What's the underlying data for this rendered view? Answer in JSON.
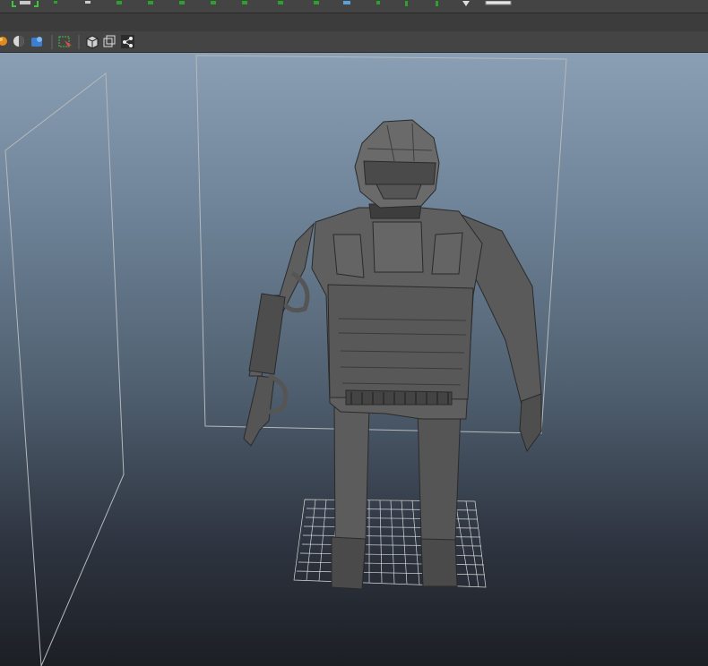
{
  "app": {
    "name": "3D viewport"
  },
  "colors": {
    "toolbar_bg": "#444444",
    "viewport_top": "#8a9fb3",
    "viewport_bottom": "#1c1f24",
    "model_gray": "#5a5a5a",
    "grid_line": "#d0d0d0",
    "camera_frame": "#b5b9bd"
  },
  "toolbar": {
    "icons": [
      "sphere-icon",
      "half-sphere-icon",
      "render-icon",
      "select-icon",
      "cube-icon",
      "wire-cube-icon",
      "share-icon"
    ]
  },
  "scene": {
    "objects": [
      "character-model",
      "floor-grid",
      "camera-frame-left",
      "camera-frame-main"
    ]
  }
}
